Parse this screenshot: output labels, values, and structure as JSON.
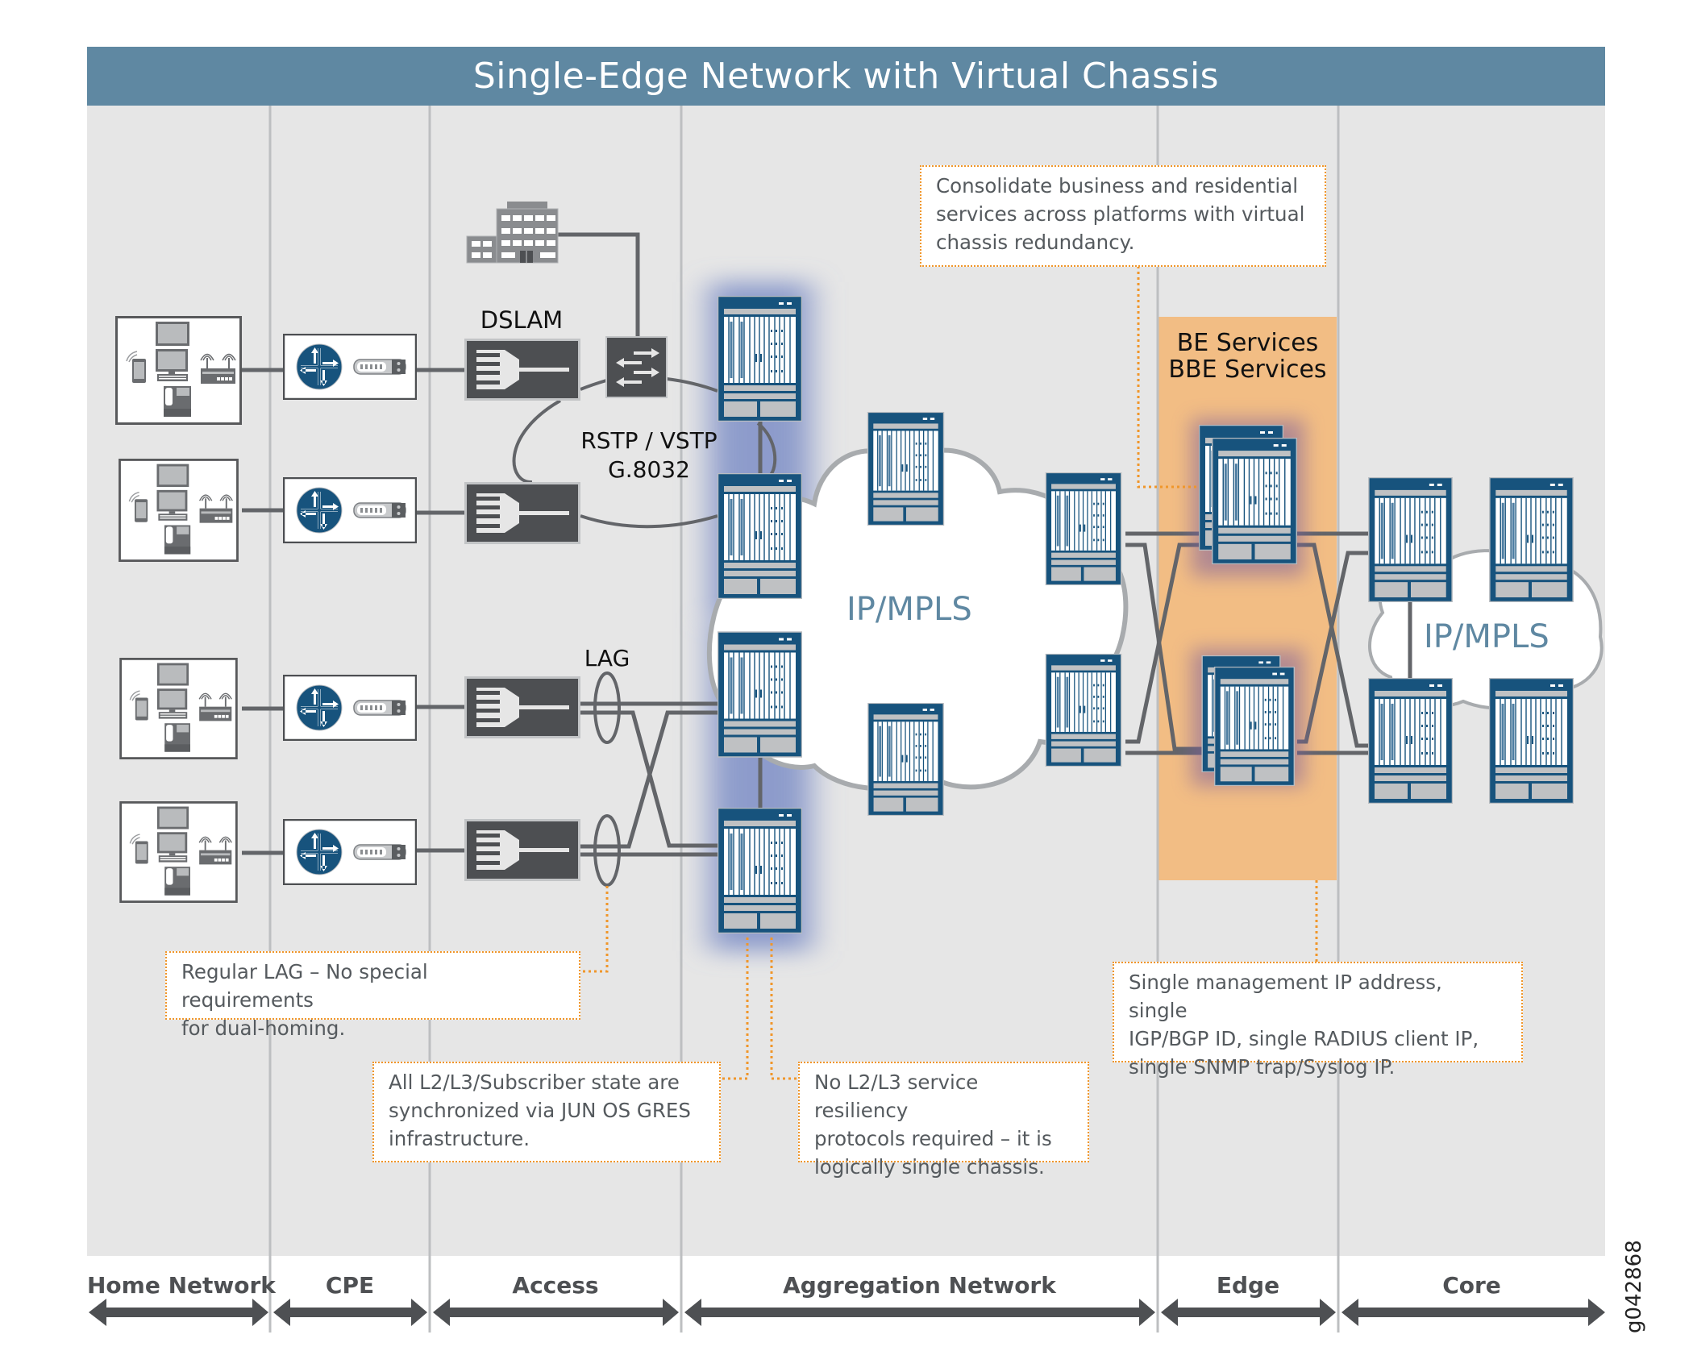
{
  "title": "Single-Edge Network with Virtual Chassis",
  "figure_id": "g042868",
  "colors": {
    "title_bar": "#5f88a2",
    "background": "#e6e6e6",
    "chassis_blue": "#17537d",
    "device_dark": "#4d4f52",
    "edge_highlight": "#f2bd84",
    "annotation_border": "#f0962a",
    "vc_glow": "#7e8fc7",
    "cloud_text": "#5f88a2"
  },
  "sections": [
    {
      "id": "home",
      "label": "Home Network"
    },
    {
      "id": "cpe",
      "label": "CPE"
    },
    {
      "id": "access",
      "label": "Access"
    },
    {
      "id": "aggregation",
      "label": "Aggregation Network"
    },
    {
      "id": "edge",
      "label": "Edge"
    },
    {
      "id": "core",
      "label": "Core"
    }
  ],
  "labels": {
    "dslam": "DSLAM",
    "ring_protocols_line1": "RSTP / VSTP",
    "ring_protocols_line2": "G.8032",
    "lag": "LAG",
    "aggregation_cloud": "IP/MPLS",
    "core_cloud": "IP/MPLS",
    "edge_services_line1": "BE Services",
    "edge_services_line2": "BBE Services"
  },
  "annotations": {
    "consolidate": "Consolidate business and residential\nservices across platforms with virtual\nchassis redundancy.",
    "single_mgmt": "Single management IP address, single\nIGP/BGP ID, single RADIUS client IP,\nsingle SNMP trap/Syslog IP.",
    "regular_lag": "Regular LAG – No special requirements\nfor dual-homing.",
    "gres_sync": "All L2/L3/Subscriber state are\nsynchronized via JUN OS GRES\ninfrastructure.",
    "no_resiliency": "No L2/L3 service resiliency\nprotocols required – it is\nlogically single chassis."
  },
  "nodes": {
    "home_networks": [
      {
        "id": "home-1",
        "icons": [
          "tv-icon",
          "desktop-computer-icon",
          "smartphone-icon",
          "wireless-router-icon",
          "ip-phone-icon"
        ]
      },
      {
        "id": "home-2",
        "icons": [
          "tv-icon",
          "desktop-computer-icon",
          "smartphone-icon",
          "wireless-router-icon",
          "ip-phone-icon"
        ]
      },
      {
        "id": "home-3",
        "icons": [
          "tv-icon",
          "desktop-computer-icon",
          "smartphone-icon",
          "wireless-router-icon",
          "ip-phone-icon"
        ]
      },
      {
        "id": "home-4",
        "icons": [
          "tv-icon",
          "desktop-computer-icon",
          "smartphone-icon",
          "wireless-router-icon",
          "ip-phone-icon"
        ]
      }
    ],
    "cpe_routers": 4,
    "dslams": 4,
    "access_switch": 1,
    "business_building": 1,
    "aggregation_vc_chassis": 4,
    "aggregation_cloud_chassis": 4,
    "edge_vc_chassis_pairs": 2,
    "core_chassis": 4
  }
}
